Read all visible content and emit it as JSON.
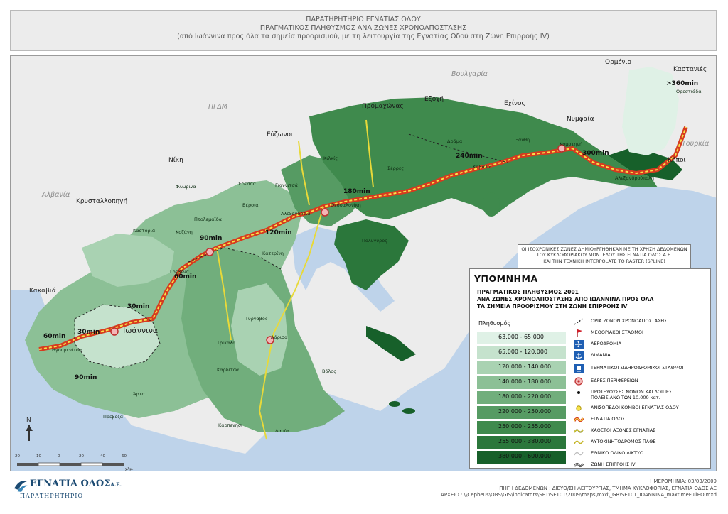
{
  "header": {
    "line1": "ΠΑΡΑΤΗΡΗΤΗΡΙΟ ΕΓΝΑΤΙΑΣ ΟΔΟΥ",
    "line2": "ΠΡΑΓΜΑΤΙΚΟΣ ΠΛΗΘΥΣΜΟΣ ΑΝΑ ΖΩΝΕΣ ΧΡΟΝΟΑΠΟΣΤΑΣΗΣ",
    "line3": "(από Ιωάννινα προς όλα τα σημεία προορισμού, με τη  λειτουργία της Εγνατίας Οδού στη Ζώνη Επιρροής IV)"
  },
  "map": {
    "countries": {
      "bulgaria": "Βουλγαρία",
      "fyrom": "ΠΓΔΜ",
      "albania": "Αλβανία",
      "turkey": "Τουρκία"
    },
    "border_stations": {
      "ormenio": "Ορμένιο",
      "kastanies": "Καστανιές",
      "orestiada": "Ορεστιάδα",
      "promachonas": "Προμαχώνας",
      "exochi": "Εξοχή",
      "echinos": "Εχίνος",
      "nymfaia": "Νυμφαία",
      "kipoi": "Κήποι",
      "evzonoi": "Εύζωνοι",
      "niki": "Νίκη",
      "krystallopigi": "Κρυσταλλοπηγή",
      "kakavia": "Κακαβιά"
    },
    "time_labels": {
      "t360": ">360min",
      "t300": "300min",
      "t240": "240min",
      "t180": "180min",
      "t120": "120min",
      "t90a": "90min",
      "t60a": "60min",
      "t30a": "30min",
      "t30b": "30min",
      "t60b": "60min",
      "t90b": "90min"
    },
    "cities": {
      "ioannina": "Ιωάννινα",
      "serres": "Σέρρες",
      "drama": "Δράμα",
      "xanthi": "Ξάνθη",
      "kavala": "Καβάλα",
      "komotini": "Κομοτηνή",
      "alexandroupoli": "Αλεξανδρούπολη",
      "kilkis": "Κιλκίς",
      "thessaloniki": "Θεσσαλονίκη",
      "polygyros": "Πολύγυρος",
      "katerini": "Κατερίνη",
      "larisa": "Λάρισα",
      "volos": "Βόλος",
      "trikala": "Τρίκαλα",
      "karditsa": "Καρδίτσα",
      "kozani": "Κοζάνη",
      "kastoria": "Καστοριά",
      "florina": "Φλώρινα",
      "edessa": "Έδεσσα",
      "veria": "Βέροια",
      "giannitsa": "Γιαννιτσά",
      "ptolemaida": "Πτολεμαΐδα",
      "grevena": "Γρεβενά",
      "arta": "Άρτα",
      "preveza": "Πρέβεζα",
      "karpenisi": "Καρπενήσι",
      "lamia": "Λαμία",
      "igoumenitsa": "Ηγουμενίτσα",
      "tyrnavos": "Τύρναβος",
      "alexandreia": "Αλεξάνδρεια"
    }
  },
  "note": {
    "line1": "ΟΙ ΙΣΟΧΡΟΝΙΚΕΣ ΖΩΝΕΣ ΔΗΜΙΟΥΡΓΗΘΗΚΑΝ ΜΕ ΤΗ ΧΡΗΣΗ ΔΕΔΟΜΕΝΩΝ",
    "line2": "ΤΟΥ ΚΥΚΛΟΦΟΡΙΑΚΟΥ ΜΟΝΤΕΛΟΥ ΤΗΣ ΕΓΝΑΤΙΑ ΟΔΟΣ Α.Ε.",
    "line3": "ΚΑΙ ΤΗΝ ΤΕΧΝΙΚΗ INTERPOLATE TO RASTER (SPLINE)"
  },
  "legend": {
    "title": "ΥΠΟΜΝΗΜΑ",
    "subtitle1": "ΠΡΑΓΜΑΤΙΚΟΣ ΠΛΗΘΥΣΜΟΣ 2001",
    "subtitle2": "ΑΝΑ ΖΩΝΕΣ ΧΡΟΝΟΑΠΟΣΤΑΣΗΣ ΑΠΟ ΙΩΑΝΝΙΝΑ ΠΡΟΣ ΟΛΑ",
    "subtitle3": "ΤΑ ΣΗΜΕΙΑ ΠΡΟΟΡΙΣΜΟΥ ΣΤΗ ΖΩΝΗ ΕΠΙΡΡΟΗΣ IV",
    "population_label": "Πληθυσμός",
    "population_classes": [
      {
        "label": "63.000 - 65.000",
        "color": "#dff1e6"
      },
      {
        "label": "65.000 - 120.000",
        "color": "#c5e2cd"
      },
      {
        "label": "120.000 - 140.000",
        "color": "#a9d2b2"
      },
      {
        "label": "140.000 - 180.000",
        "color": "#8cc096"
      },
      {
        "label": "180.000 - 220.000",
        "color": "#71ae7c"
      },
      {
        "label": "220.000 - 250.000",
        "color": "#569b63"
      },
      {
        "label": "250.000 - 255.000",
        "color": "#3f8a4d"
      },
      {
        "label": "255.000 - 380.000",
        "color": "#2b773b"
      },
      {
        "label": "380.000 - 600.000",
        "color": "#17602a"
      }
    ],
    "symbols": [
      {
        "icon": "zone-boundary-icon",
        "label": "ΟΡΙΑ ΖΩΝΩΝ ΧΡΟΝΟΑΠΟΣΤΑΣΗΣ"
      },
      {
        "icon": "border-station-icon",
        "label": "ΜΕΘΟΡΙΑΚΟΙ ΣΤΑΘΜΟΙ"
      },
      {
        "icon": "airport-icon",
        "label": "ΑΕΡΟΔΡΟΜΙΑ"
      },
      {
        "icon": "port-icon",
        "label": "ΛΙΜΑΝΙΑ"
      },
      {
        "icon": "rail-terminal-icon",
        "label": "ΤΕΡΜΑΤΙΚΟΙ ΣΙΔΗΡΟΔΡΟΜΙΚΟΙ ΣΤΑΘΜΟΙ"
      },
      {
        "icon": "region-seat-icon",
        "label": "ΕΔΡΕΣ ΠΕΡΙΦΕΡΕΙΩΝ"
      },
      {
        "icon": "capital-dot-icon",
        "label": "ΠΡΩΤΕΥΟΥΣΕΣ ΝΟΜΩΝ ΚΑΙ ΛΟΙΠΕΣ",
        "label2": "ΠΟΛΕΙΣ ΑΝΩ ΤΩΝ 10.000 κατ."
      },
      {
        "icon": "interchange-icon",
        "label": "ΑΝΙΣΟΠΕΔΟΙ ΚΟΜΒΟΙ ΕΓΝΑΤΙΑΣ ΟΔΟΥ"
      },
      {
        "icon": "egnatia-road-icon",
        "label": "ΕΓΝΑΤΙΑ ΟΔΟΣ"
      },
      {
        "icon": "vertical-axis-icon",
        "label": "ΚΑΘΕΤΟΙ ΑΞΟΝΕΣ ΕΓΝΑΤΙΑΣ"
      },
      {
        "icon": "pathe-motorway-icon",
        "label": "ΑΥΤΟΚΙΝΗΤΟΔΡΟΜΟΣ ΠΑΘΕ"
      },
      {
        "icon": "national-road-icon",
        "label": "ΕΘΝΙΚΟ ΟΔΙΚΟ ΔΙΚΤΥΟ"
      },
      {
        "icon": "influence-zone-icon",
        "label": "ΖΩΝΗ ΕΠΙΡΡΟΗΣ IV"
      }
    ]
  },
  "scale": {
    "north": "N",
    "ticks": [
      "20",
      "10",
      "0",
      "20",
      "40",
      "60"
    ],
    "unit": "χλμ."
  },
  "footer": {
    "logo": "ΕΓΝΑΤΙΑ ΟΔΟΣ",
    "logo_suffix": "Α.Ε.",
    "logo_sub": "ΠΑΡΑΤΗΡΗΤΗΡΙΟ",
    "date": "ΗΜΕΡΟΜΗΝΙΑ: 03/03/2009",
    "source": "ΠΗΓΗ ΔΕΔΟΜΕΝΩΝ : ΔΙΕΥΘ/ΣΗ ΛΕΙΤΟΥΡΓΙΑΣ, ΤΜΗΜΑ ΚΥΚΛΟΦΟΡΙΑΣ, ΕΓΝΑΤΙΑ ΟΔΟΣ ΑΕ",
    "file": "ΑΡΧΕΙΟ : \\\\Cepheus\\OBS\\GIS\\indicators\\SET\\SET01\\2009\\maps\\mxd\\_GR\\SET01_IOANNINA_maxtimeFullEO.mxd"
  }
}
